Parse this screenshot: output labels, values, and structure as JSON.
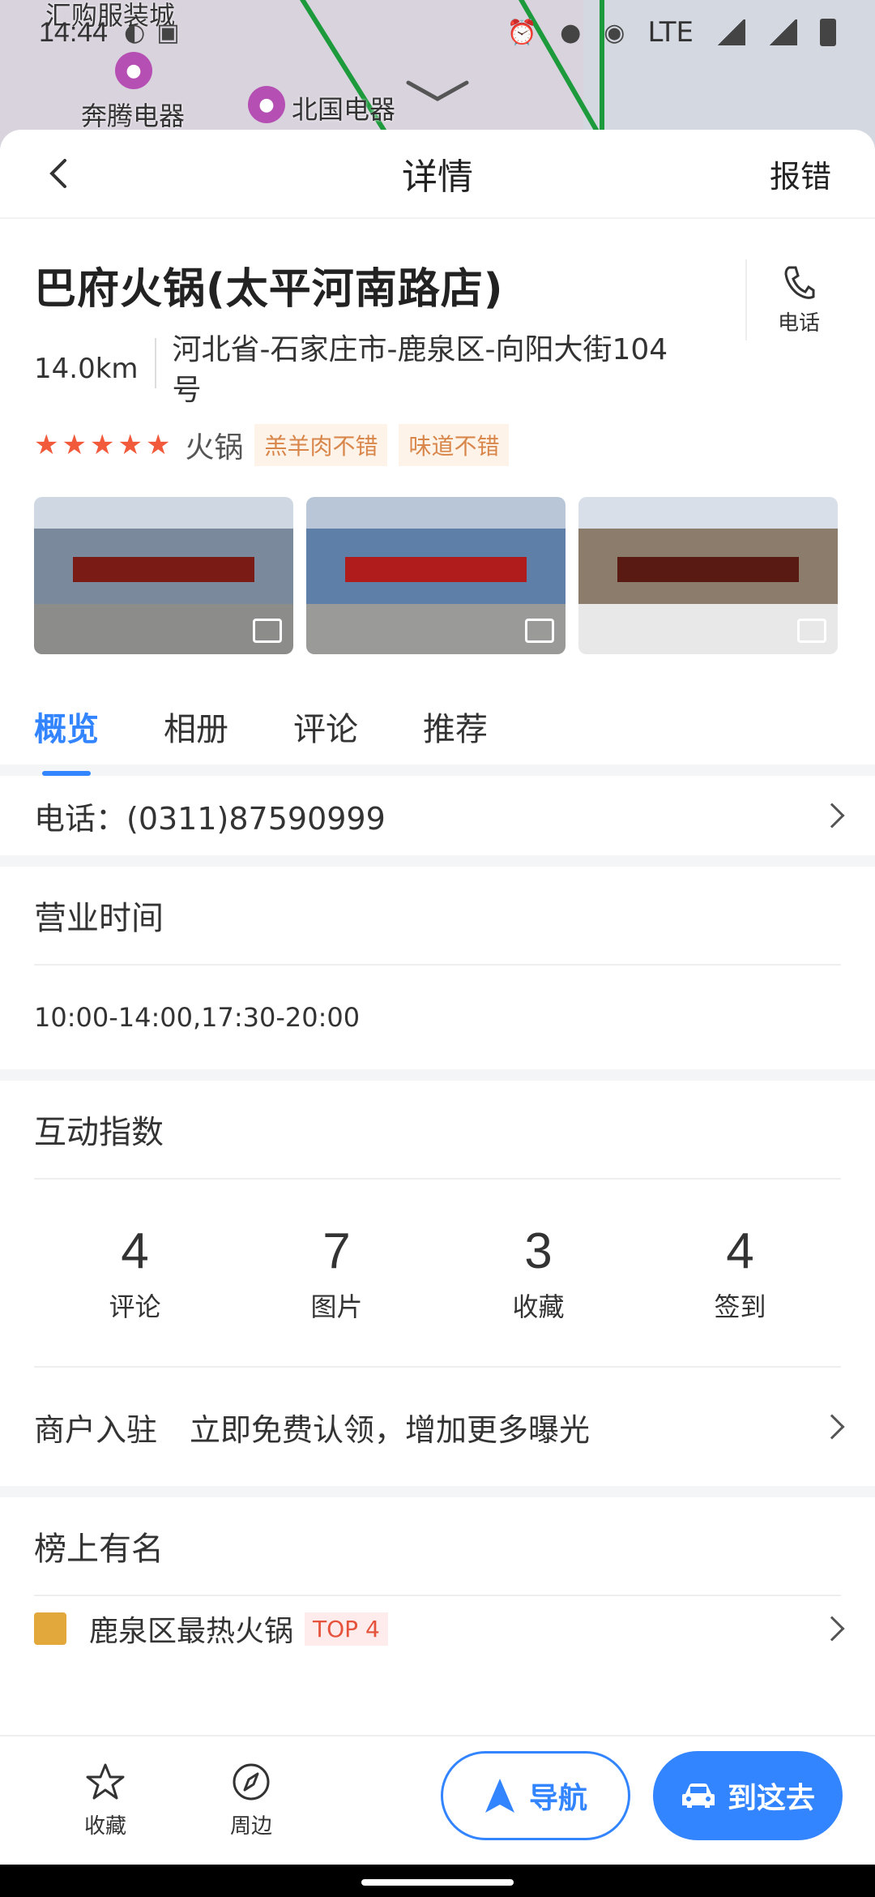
{
  "status": {
    "time": "14:44",
    "network": "LTE",
    "icons": [
      "wechat-icon",
      "didi-icon",
      "alarm-icon",
      "mic-icon",
      "location-icon",
      "signal-icon",
      "battery-icon"
    ]
  },
  "map": {
    "labels": [
      "汇购服装城",
      "奔腾电器",
      "北国电器"
    ]
  },
  "topbar": {
    "title": "详情",
    "report": "报错"
  },
  "place": {
    "name": "巴府火锅(太平河南路店)",
    "phone_btn": "电话",
    "distance": "14.0km",
    "address": "河北省-石家庄市-鹿泉区-向阳大街104号",
    "rating_stars": 5,
    "category": "火锅",
    "tags": [
      "羔羊肉不错",
      "味道不错"
    ]
  },
  "tabs": [
    "概览",
    "相册",
    "评论",
    "推荐"
  ],
  "phone_row": "电话：(0311)87590999",
  "hours": {
    "title": "营业时间",
    "value": "10:00-14:00,17:30-20:00"
  },
  "interaction": {
    "title": "互动指数",
    "stats": [
      {
        "num": "4",
        "label": "评论"
      },
      {
        "num": "7",
        "label": "图片"
      },
      {
        "num": "3",
        "label": "收藏"
      },
      {
        "num": "4",
        "label": "签到"
      }
    ],
    "merchant_label": "商户入驻",
    "merchant_sub": "立即免费认领，增加更多曝光"
  },
  "ranking": {
    "title": "榜上有名",
    "item": "鹿泉区最热火锅",
    "tag": "TOP 4"
  },
  "bottom": {
    "fav": "收藏",
    "nearby": "周边",
    "navigate": "导航",
    "go": "到这去"
  },
  "colors": {
    "accent": "#3385ff",
    "star": "#f25a3c",
    "tag_text": "#d9864a"
  }
}
